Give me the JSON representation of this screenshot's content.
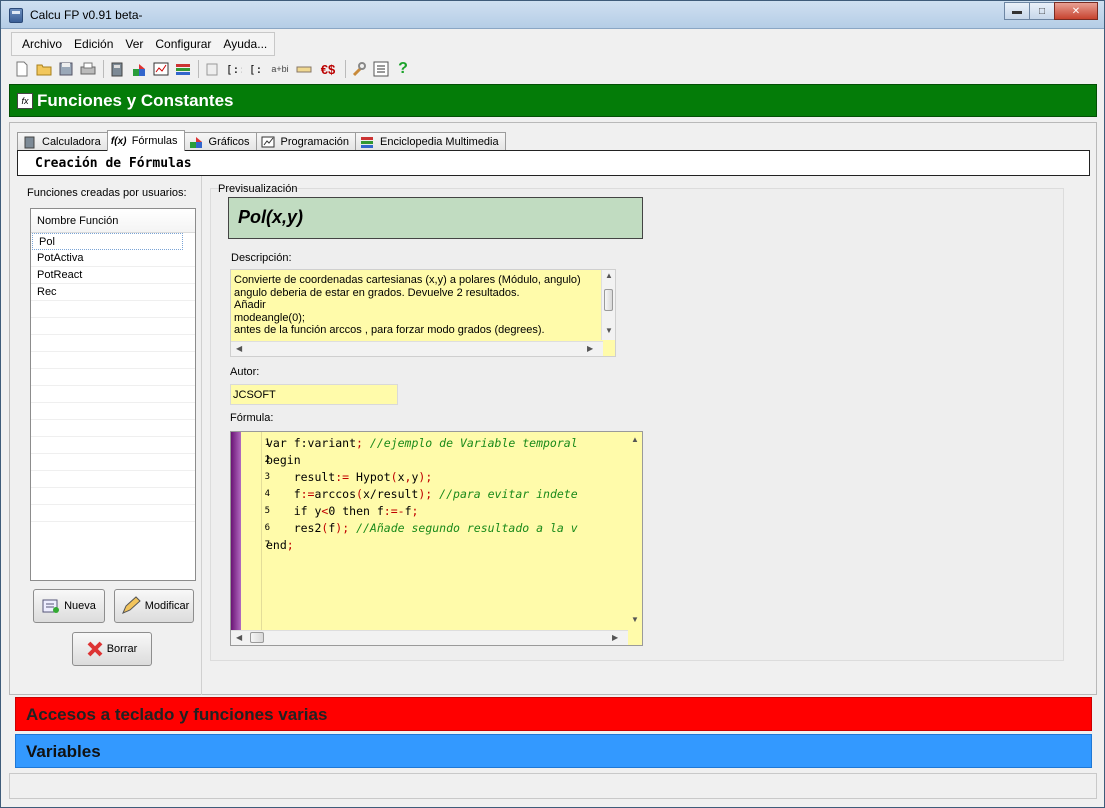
{
  "window": {
    "title": "Calcu FP  v0.91 beta-"
  },
  "menu": [
    "Archivo",
    "Edición",
    "Ver",
    "Configurar",
    "Ayuda..."
  ],
  "toolbar_icons": [
    "new-file-icon",
    "open-folder-icon",
    "save-icon",
    "print-icon",
    "calculator-icon",
    "graph-icon",
    "chart-icon",
    "books-icon",
    "clipboard-icon",
    "matrix-icon",
    "vector-icon",
    "complex-icon",
    "ruler-icon",
    "currency-icon",
    "wrench-icon",
    "list-icon",
    "help-icon"
  ],
  "toolbar_text": {
    "complex": "a+bi",
    "currency": "€$",
    "help": "?"
  },
  "sections": {
    "funciones": "Funciones y Constantes",
    "accesos": "Accesos a teclado y funciones varias",
    "variables": "Variables"
  },
  "colors": {
    "green": "#047c08",
    "red": "#ff0000",
    "blue": "#3399ff",
    "yellow_field": "#fffbaa",
    "preview_bg": "#c1dcc1"
  },
  "tabs": [
    "Calculadora",
    "Fórmulas",
    "Gráficos",
    "Programación",
    "Enciclopedia Multimedia"
  ],
  "active_tab": "Fórmulas",
  "subheader": "Creación de Fórmulas",
  "left": {
    "title": "Funciones creadas por usuarios:",
    "column": "Nombre Función",
    "items": [
      "Pol",
      "PotActiva",
      "PotReact",
      "Rec"
    ],
    "selected": "Pol"
  },
  "buttons": {
    "nueva": "Nueva",
    "modificar": "Modificar",
    "borrar": "Borrar"
  },
  "preview": {
    "label": "Previsualización",
    "value": "Pol(x,y)"
  },
  "description": {
    "label": "Descripción:",
    "text": "Convierte de coordenadas cartesianas (x,y) a polares (Módulo, angulo)\nangulo deberia de estar en grados. Devuelve 2 resultados.\nAñadir\nmodeangle(0);\nantes de la función arccos , para forzar modo grados (degrees)."
  },
  "author": {
    "label": "Autor:",
    "value": "JCSOFT"
  },
  "formula": {
    "label": "Fórmula:",
    "line_numbers": [
      "1",
      "2",
      "3",
      "4",
      "5",
      "6",
      "7"
    ],
    "lines": [
      "var f:variant; //ejemplo de Variable temporal",
      "begin",
      "    result:= Hypot(x,y);",
      "    f:=arccos(x/result); //para evitar indete",
      "    if y<0 then f:=-f;",
      "    res2(f); //Añade segundo resultado a la v",
      "end;"
    ]
  }
}
